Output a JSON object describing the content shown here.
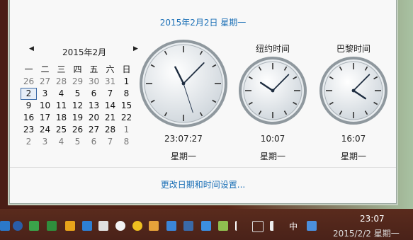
{
  "panel": {
    "date_title": "2015年2月2日  星期一",
    "settings_link": "更改日期和时间设置..."
  },
  "calendar": {
    "prev_icon": "chevron-left-icon",
    "next_icon": "chevron-right-icon",
    "prev_glyph": "◀",
    "next_glyph": "▶",
    "month_label": "2015年2月",
    "weekday_headers": [
      "一",
      "二",
      "三",
      "四",
      "五",
      "六",
      "日"
    ],
    "weeks": [
      [
        "26",
        "27",
        "28",
        "29",
        "30",
        "31",
        "1"
      ],
      [
        "2",
        "3",
        "4",
        "5",
        "6",
        "7",
        "8"
      ],
      [
        "9",
        "10",
        "11",
        "12",
        "13",
        "14",
        "15"
      ],
      [
        "16",
        "17",
        "18",
        "19",
        "20",
        "21",
        "22"
      ],
      [
        "23",
        "24",
        "25",
        "26",
        "27",
        "28",
        "1"
      ],
      [
        "2",
        "3",
        "4",
        "5",
        "6",
        "7",
        "8"
      ]
    ],
    "today": "2"
  },
  "clocks": [
    {
      "name": "",
      "time": "23:07:27",
      "weekday": "星期一",
      "hour": 23,
      "minute": 7,
      "second": 27
    },
    {
      "name": "纽约时间",
      "time": "10:07",
      "weekday": "星期一",
      "hour": 10,
      "minute": 7,
      "second": 27
    },
    {
      "name": "巴黎时间",
      "time": "16:07",
      "weekday": "星期一",
      "hour": 16,
      "minute": 7,
      "second": 27
    }
  ],
  "taskbar": {
    "time": "23:07",
    "date": "2015/2/2  星期一",
    "ime_label": "中",
    "icons": [
      "windows-icon",
      "clock-icon",
      "shield-icon",
      "bing-icon",
      "pen-icon",
      "doc-icon",
      "cloud-icon",
      "plus-icon",
      "search-icon",
      "globe-icon",
      "mail-icon",
      "network-icon",
      "check-shield-icon",
      "flag-icon",
      "wifi-icon",
      "volume-icon",
      "ime-icon",
      "keyboard-icon"
    ]
  }
}
